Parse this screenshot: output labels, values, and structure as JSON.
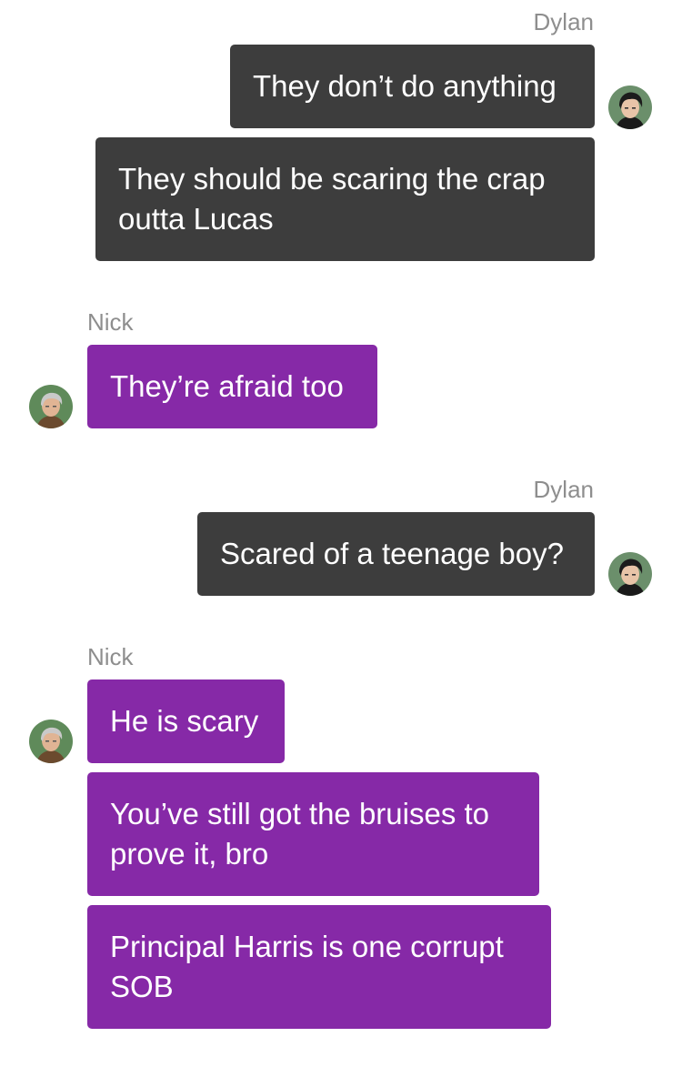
{
  "conversation": {
    "groups": [
      {
        "sender": "Dylan",
        "side": "right",
        "messages": [
          "They don’t do anything",
          "They should be scaring the crap outta Lucas"
        ]
      },
      {
        "sender": "Nick",
        "side": "left",
        "messages": [
          "They’re afraid too"
        ]
      },
      {
        "sender": "Dylan",
        "side": "right",
        "messages": [
          "Scared of a teenage boy?"
        ]
      },
      {
        "sender": "Nick",
        "side": "left",
        "messages": [
          "He is scary",
          "You’ve still got the bruises to prove it, bro",
          "Principal Harris is one corrupt SOB"
        ]
      }
    ]
  },
  "avatars": {
    "dylan": {
      "icon": "dylan-avatar-icon",
      "bg_color": "#6b8f6b",
      "hair_color": "#1c1c1c",
      "shirt_color": "#1a1a1a"
    },
    "nick": {
      "icon": "nick-avatar-icon",
      "bg_color": "#5f8a5a",
      "hair_color": "#c9c9c9",
      "shirt_color": "#6b4a2e"
    }
  },
  "colors": {
    "dylan_bubble": "#3d3d3d",
    "nick_bubble": "#8629a7",
    "name_text": "#8e8e8e"
  }
}
